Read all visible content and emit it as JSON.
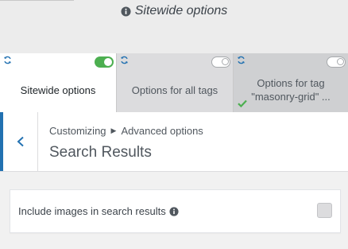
{
  "scope_heading": {
    "text": "Sitewide options",
    "icon": "info-icon"
  },
  "tabs": [
    {
      "label": "Sitewide options",
      "active": true,
      "toggle": "on",
      "icon": "sync-icon"
    },
    {
      "label": "Options for all tags",
      "active": false,
      "toggle": "off",
      "icon": "sync-icon"
    },
    {
      "label": "Options for tag \"masonry-grid\" ...",
      "active": false,
      "toggle": "off",
      "icon": "sync-icon",
      "status": "check-icon"
    }
  ],
  "header": {
    "breadcrumb": [
      "Customizing",
      "Advanced options"
    ],
    "title": "Search Results",
    "back_icon": "chevron-left-icon"
  },
  "option": {
    "label": "Include images in search results",
    "checked": false
  },
  "colors": {
    "accent": "#2271b1",
    "toggle_on": "#4caf50",
    "check": "#4caf50"
  }
}
